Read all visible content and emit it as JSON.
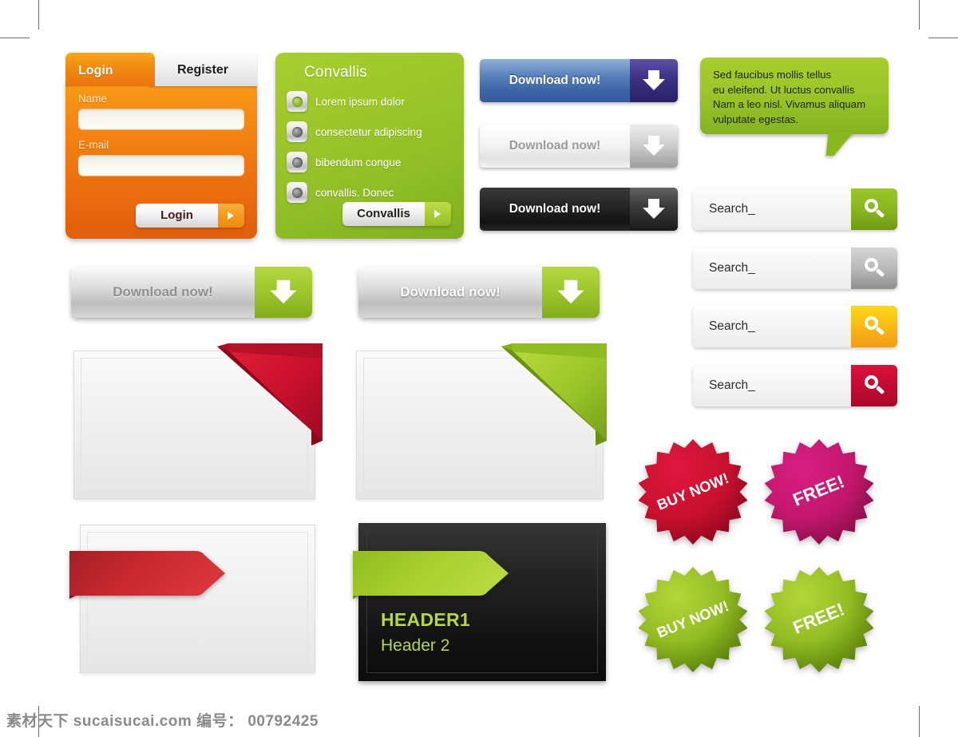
{
  "login_panel": {
    "tab_login": "Login",
    "tab_register": "Register",
    "name_label": "Name",
    "name_value": "",
    "name_placeholder": "",
    "email_label": "E-mail",
    "email_value": "",
    "email_placeholder": "",
    "submit_label": "Login",
    "accent": "#ef8010"
  },
  "convallis_panel": {
    "title": "Convallis",
    "items": [
      {
        "label": "Lorem   ipsum   dolor",
        "selected": true
      },
      {
        "label": "consectetur adipiscing",
        "selected": false
      },
      {
        "label": "bibendum  congue",
        "selected": false
      },
      {
        "label": "convallis.  Donec",
        "selected": false
      }
    ],
    "button_label": "Convallis",
    "accent": "#9cc62a"
  },
  "download_buttons_small": [
    {
      "label": "Download now!",
      "variant": "blue",
      "accent": "#3c63a4"
    },
    {
      "label": "Download now!",
      "variant": "gray",
      "accent": "#cfcfcf"
    },
    {
      "label": "Download now!",
      "variant": "black",
      "accent": "#1b1b1b"
    }
  ],
  "download_buttons_large": [
    {
      "label": "Download now!",
      "variant": "gray-text-gray",
      "accent": "#9ec82c"
    },
    {
      "label": "Download now!",
      "variant": "gray-text-white",
      "accent": "#9ec82c"
    }
  ],
  "speech_bubble": {
    "text": "Sed faucibus mollis tellus eu eleifend. Ut luctus convallis Nam a leo nisl. Vivamus aliquam vulputate egestas.",
    "lines": [
      "Sed faucibus mollis tellus",
      "eu eleifend. Ut luctus convallis",
      "Nam a leo nisl. Vivamus aliquam",
      "vulputate egestas."
    ],
    "accent": "#9bc529"
  },
  "search_bars": [
    {
      "value": "Search_",
      "placeholder": "Search_",
      "variant": "green",
      "accent": "#87b41f",
      "icon": "magnifier-icon"
    },
    {
      "value": "Search_",
      "placeholder": "Search_",
      "variant": "gray",
      "accent": "#b6b6b6",
      "icon": "magnifier-icon"
    },
    {
      "value": "Search_",
      "placeholder": "Search_",
      "variant": "yellow",
      "accent": "#f7b318",
      "icon": "magnifier-icon"
    },
    {
      "value": "Search_",
      "placeholder": "Search_",
      "variant": "red",
      "accent": "#c20b32",
      "icon": "magnifier-icon"
    }
  ],
  "ribbon_boxes": [
    {
      "ribbon_color": "#c8102e",
      "ribbon_position": "top-right",
      "content": ""
    },
    {
      "ribbon_color": "#9cc62a",
      "ribbon_position": "top-right",
      "content": ""
    }
  ],
  "arrow_boxes": [
    {
      "arrow_color": "#c8282f",
      "theme": "light",
      "heading1": "",
      "heading2": ""
    },
    {
      "arrow_color": "#a8ce2e",
      "theme": "dark",
      "heading1": "HEADER1",
      "heading2": "Header 2"
    }
  ],
  "badges": [
    {
      "label": "BUY NOW!",
      "color": "#c8102e",
      "name": "badge-buy-now-red"
    },
    {
      "label": "FREE!",
      "color": "#c2176c",
      "name": "badge-free-pink"
    },
    {
      "label": "BUY NOW!",
      "color": "#7fae1f",
      "name": "badge-buy-now-green"
    },
    {
      "label": "FREE!",
      "color": "#7fae1f",
      "name": "badge-free-green"
    }
  ],
  "watermark": {
    "site": "素材天下 sucaisucai.com",
    "id_label": "编号：",
    "id_value": "00792425",
    "full": "素材天下 sucaisucai.com  编号： 00792425"
  }
}
